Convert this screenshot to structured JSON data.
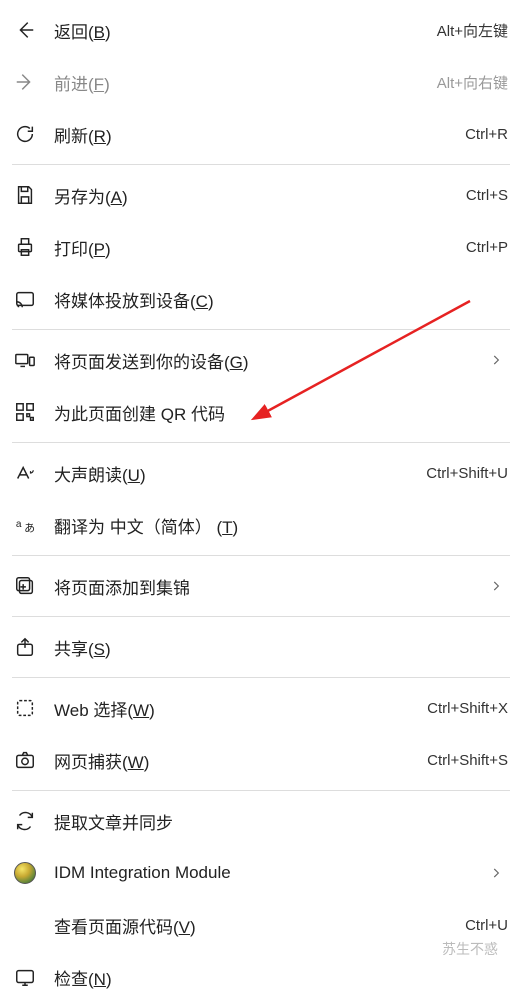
{
  "items": [
    {
      "id": "back",
      "label": "返回(",
      "ul": "B",
      "labelEnd": ")",
      "shortcut": "Alt+向左键",
      "icon": "arrow-left",
      "disabled": false
    },
    {
      "id": "forward",
      "label": "前进(",
      "ul": "F",
      "labelEnd": ")",
      "shortcut": "Alt+向右键",
      "icon": "arrow-right",
      "disabled": true
    },
    {
      "id": "refresh",
      "label": "刷新(",
      "ul": "R",
      "labelEnd": ")",
      "shortcut": "Ctrl+R",
      "icon": "refresh",
      "disabled": false
    },
    {
      "divider": true
    },
    {
      "id": "saveas",
      "label": "另存为(",
      "ul": "A",
      "labelEnd": ")",
      "shortcut": "Ctrl+S",
      "icon": "save",
      "disabled": false
    },
    {
      "id": "print",
      "label": "打印(",
      "ul": "P",
      "labelEnd": ")",
      "shortcut": "Ctrl+P",
      "icon": "print",
      "disabled": false
    },
    {
      "id": "cast",
      "label": "将媒体投放到设备(",
      "ul": "C",
      "labelEnd": ")",
      "shortcut": "",
      "icon": "cast",
      "disabled": false
    },
    {
      "divider": true
    },
    {
      "id": "senddevice",
      "label": "将页面发送到你的设备(",
      "ul": "G",
      "labelEnd": ")",
      "shortcut": "",
      "icon": "devices",
      "submenu": true
    },
    {
      "id": "qrcode",
      "label": "为此页面创建 QR 代码",
      "ul": "",
      "labelEnd": "",
      "shortcut": "",
      "icon": "qr",
      "disabled": false
    },
    {
      "divider": true
    },
    {
      "id": "readaloud",
      "label": "大声朗读(",
      "ul": "U",
      "labelEnd": ")",
      "shortcut": "Ctrl+Shift+U",
      "icon": "read",
      "disabled": false
    },
    {
      "id": "translate",
      "label": "翻译为 中文（简体） (",
      "ul": "T",
      "labelEnd": ")",
      "shortcut": "",
      "icon": "translate",
      "disabled": false
    },
    {
      "divider": true
    },
    {
      "id": "collections",
      "label": "将页面添加到集锦",
      "ul": "",
      "labelEnd": "",
      "shortcut": "",
      "icon": "collections",
      "submenu": true
    },
    {
      "divider": true
    },
    {
      "id": "share",
      "label": "共享(",
      "ul": "S",
      "labelEnd": ")",
      "shortcut": "",
      "icon": "share",
      "disabled": false
    },
    {
      "divider": true
    },
    {
      "id": "webselect",
      "label": "Web 选择(",
      "ul": "W",
      "labelEnd": ")",
      "shortcut": "Ctrl+Shift+X",
      "icon": "webselect",
      "disabled": false
    },
    {
      "id": "capture",
      "label": "网页捕获(",
      "ul": "W",
      "labelEnd": ")",
      "shortcut": "Ctrl+Shift+S",
      "icon": "capture",
      "disabled": false
    },
    {
      "divider": true
    },
    {
      "id": "extract",
      "label": "提取文章并同步",
      "ul": "",
      "labelEnd": "",
      "shortcut": "",
      "icon": "sync",
      "disabled": false
    },
    {
      "id": "idm",
      "label": "IDM Integration Module",
      "ul": "",
      "labelEnd": "",
      "shortcut": "",
      "icon": "idm",
      "submenu": true
    },
    {
      "id": "viewsource",
      "label": "查看页面源代码(",
      "ul": "V",
      "labelEnd": ")",
      "shortcut": "Ctrl+U",
      "icon": "",
      "disabled": false
    },
    {
      "id": "inspect",
      "label": "检查(",
      "ul": "N",
      "labelEnd": ")",
      "shortcut": "",
      "icon": "inspect",
      "disabled": false
    }
  ],
  "watermark": "苏生不惑"
}
